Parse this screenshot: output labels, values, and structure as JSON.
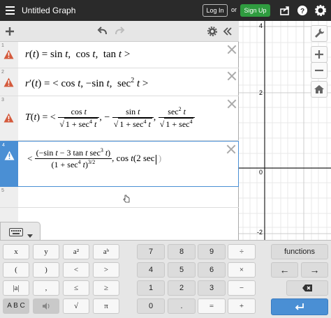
{
  "topbar": {
    "title": "Untitled Graph",
    "login_label": "Log In",
    "or_label": "or",
    "signup_label": "Sign Up"
  },
  "expressions": [
    {
      "num": "1",
      "warning": true,
      "math": "r(t) = sin t, cos t, tan t >"
    },
    {
      "num": "2",
      "warning": true,
      "math": "r′(t) = < cos t, −sin t, sec² t >"
    },
    {
      "num": "3",
      "warning": true,
      "math": "T(t) = < cos t / √(1+sec⁴ t), − sin t / √(1+sec⁴ t), sec² t / √(1+sec⁴ t)"
    },
    {
      "num": "4",
      "warning": true,
      "active": true,
      "math": "< (−sin t − 3 tan t sec³ t) / (1+sec⁴ t)^(3/2), cos t(2 sec )"
    },
    {
      "num": "5",
      "warning": false,
      "math": ""
    }
  ],
  "graph": {
    "y_ticks": [
      "4",
      "2",
      "0",
      "-2"
    ]
  },
  "keyboard": {
    "left": [
      [
        "x",
        "y",
        "a²",
        "aᵇ"
      ],
      [
        "(",
        ")",
        "<",
        ">"
      ],
      [
        "|a|",
        ",",
        "≤",
        "≥"
      ],
      [
        "A B C",
        "",
        "√",
        "π"
      ]
    ],
    "middle": [
      [
        "7",
        "8",
        "9",
        "÷"
      ],
      [
        "4",
        "5",
        "6",
        "×"
      ],
      [
        "1",
        "2",
        "3",
        "−"
      ],
      [
        "0",
        ".",
        "=",
        "+"
      ]
    ],
    "functions_label": "functions",
    "left_arrow": "←",
    "right_arrow": "→"
  },
  "colors": {
    "topbar": "#2a2a2a",
    "signup": "#2f9c3f",
    "warning": "#d45a3c",
    "active_border": "#4a8fd4",
    "enter_key": "#4a8fd4"
  }
}
